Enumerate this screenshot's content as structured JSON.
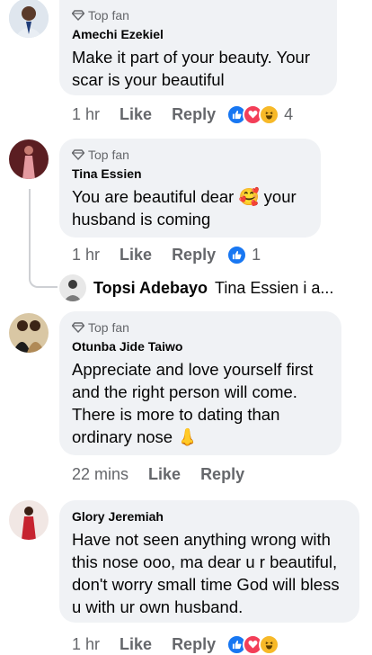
{
  "badge_label": "Top fan",
  "comments": [
    {
      "author": "Amechi Ezekiel",
      "text": "Make it part of your beauty. Your scar is your beautiful",
      "time": "1 hr",
      "like": "Like",
      "reply": "Reply",
      "reactions": [
        "like-icon",
        "love-icon",
        "haha-icon"
      ],
      "reaction_count": "4",
      "top_fan": true
    },
    {
      "author": "Tina Essien",
      "text": "You are beautiful dear 🥰 your husband is coming",
      "time": "1 hr",
      "like": "Like",
      "reply": "Reply",
      "reactions": [
        "like-icon"
      ],
      "reaction_count": "1",
      "top_fan": true
    },
    {
      "author": "Otunba Jide Taiwo",
      "text": "Appreciate and love yourself first and the right person will come. There is more to dating than ordinary nose 👃",
      "time": "22 mins",
      "like": "Like",
      "reply": "Reply",
      "top_fan": true
    },
    {
      "author": "Glory Jeremiah",
      "text": "Have not seen anything wrong with this nose ooo, ma dear u r beautiful, don't worry small time God will bless u with ur own husband.",
      "time": "1 hr",
      "like": "Like",
      "reply": "Reply",
      "reactions": [
        "like-icon",
        "love-icon",
        "haha-icon"
      ],
      "top_fan": false
    }
  ],
  "reply_preview": {
    "author": "Topsi Adebayo",
    "text": "Tina Essien i a..."
  },
  "colors": {
    "bubble": "#f0f2f5",
    "muted": "#65676b",
    "like_blue": "#1877f2",
    "love_red": "#f33e58",
    "haha_yellow": "#f7b928"
  }
}
